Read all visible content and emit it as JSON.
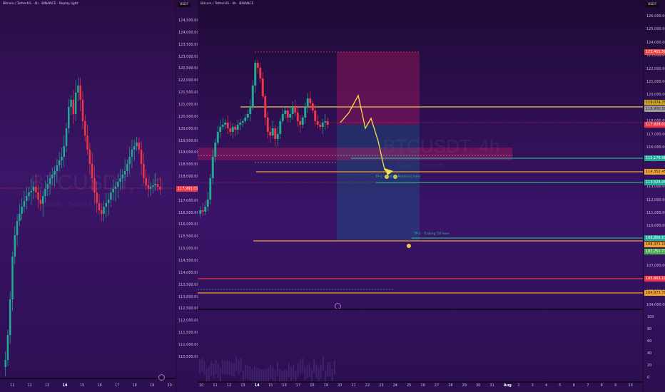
{
  "left_chart": {
    "header": "Bitcoin / TetherUS · 4h · BINANCE · Replay light",
    "watermark_symbol": "BTCUSDT, 4h",
    "watermark_sub": "Bitcoin / TetherUS",
    "currency": "USDT",
    "price_ticks": [
      "124,500.00",
      "124,000.00",
      "123,500.00",
      "123,000.00",
      "122,500.00",
      "122,000.00",
      "121,500.00",
      "121,000.00",
      "120,500.00",
      "120,000.00",
      "119,500.00",
      "119,000.00",
      "118,500.00",
      "118,000.00",
      "117,500.00",
      "117,000.00",
      "116,500.00",
      "116,000.00",
      "115,500.00",
      "115,000.00",
      "114,500.00",
      "114,000.00",
      "113,500.00",
      "113,000.00",
      "112,500.00",
      "112,000.00",
      "111,500.00",
      "111,000.00",
      "110,500.00"
    ],
    "current_price_tag": "117,991.01",
    "date_ticks": [
      "11",
      "12",
      "13",
      "14",
      "15",
      "16",
      "17",
      "18",
      "19",
      "20"
    ],
    "colors": {
      "up": "#22ab94",
      "down": "#f23645",
      "price_tag": "#f23645"
    }
  },
  "right_chart": {
    "header": "Bitcoin / TetherUS · 4h · BINANCE",
    "watermark_symbol": "BTCUSDT, 4h",
    "watermark_sub": "Bitcoin / TetherUS",
    "currency": "USDT",
    "price_ticks": [
      "126,000.00",
      "125,000.00",
      "124,000.00",
      "123,000.00",
      "122,000.00",
      "121,000.00",
      "120,000.00",
      "119,000.00",
      "118,000.00",
      "117,000.00",
      "116,000.00",
      "115,000.00",
      "114,000.00",
      "113,000.00",
      "112,000.00",
      "111,000.00",
      "110,000.00",
      "109,000.00",
      "108,000.00",
      "107,000.00",
      "106,000.00",
      "105,000.00",
      "104,000.00"
    ],
    "level_tags": [
      {
        "label": "123,401.50",
        "color": "#e8453c",
        "text_color": "#fff"
      },
      {
        "label": "119,074.75",
        "color": "#c9a227",
        "text_color": "#1a1a1a"
      },
      {
        "label": "118,900.30",
        "color": "#9e9e9e",
        "text_color": "#1a1a1a"
      },
      {
        "label": "117,928.01",
        "color": "#f23645",
        "text_color": "#fff"
      },
      {
        "label": "115,176.96",
        "color": "#22ab94",
        "text_color": "#fff"
      },
      {
        "label": "114,352.45",
        "color": "#f0a12b",
        "text_color": "#1a1a1a"
      },
      {
        "label": "113,525.05",
        "color": "#22ab94",
        "text_color": "#fff"
      },
      {
        "label": "108,866.57",
        "color": "#22ab94",
        "text_color": "#fff"
      },
      {
        "label": "108,371.18",
        "color": "#f0a12b",
        "text_color": "#1a1a1a"
      },
      {
        "label": "107,751.71",
        "color": "#4caf50",
        "text_color": "#fff"
      },
      {
        "label": "105,663.10",
        "color": "#f23645",
        "text_color": "#fff"
      },
      {
        "label": "104,973.79",
        "color": "#f0a12b",
        "text_color": "#1a1a1a"
      }
    ],
    "volume_ticks": [
      "100",
      "80",
      "60",
      "40",
      "20",
      "0"
    ],
    "date_ticks": [
      "10",
      "11",
      "12",
      "13",
      "14",
      "15",
      "16",
      "17",
      "18",
      "19",
      "20",
      "21",
      "22",
      "23",
      "24",
      "25",
      "26",
      "27",
      "28",
      "29",
      "30",
      "31",
      "Aug",
      "2",
      "3",
      "4",
      "5",
      "6",
      "7",
      "8",
      "9",
      "10"
    ],
    "annotations": {
      "tp1": "TP-1 · Trailing Positions here",
      "tp2": "TP-2 · Trailing Till here"
    }
  }
}
